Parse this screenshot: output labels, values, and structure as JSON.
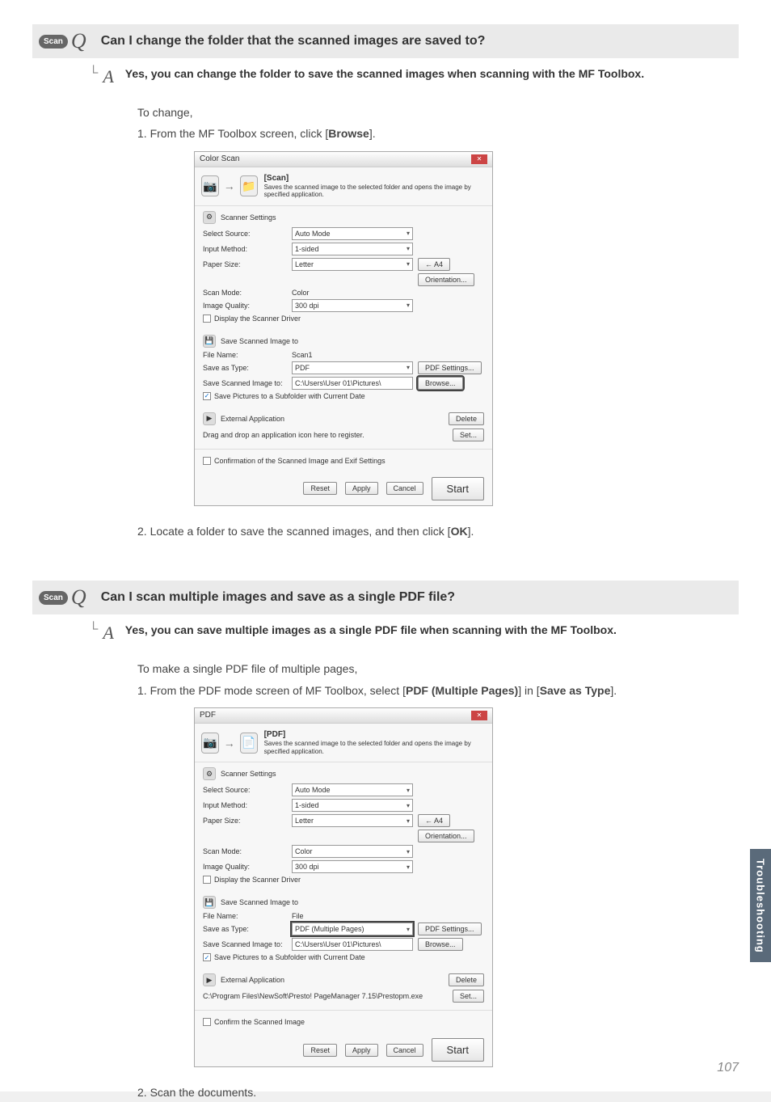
{
  "qa1": {
    "badge": "Scan",
    "q_letter": "Q",
    "a_letter": "A",
    "question": "Can I change the folder that the scanned images are saved to?",
    "answer": "Yes, you can change the folder to save the scanned images when scanning with the MF Toolbox.",
    "intro": "To change,",
    "step1_pre": "1. From the MF Toolbox screen, click [",
    "step1_bold": "Browse",
    "step1_post": "].",
    "step2_pre": "2. Locate a folder to save the scanned images, and then click [",
    "step2_bold": "OK",
    "step2_post": "]."
  },
  "dialog1": {
    "title": "Color Scan",
    "banner_title": "[Scan]",
    "banner_desc": "Saves the scanned image to the selected folder and opens the image by specified application.",
    "scanner_settings": "Scanner Settings",
    "select_source_label": "Select Source:",
    "select_source_value": "Auto Mode",
    "input_method_label": "Input Method:",
    "input_method_value": "1-sided",
    "paper_size_label": "Paper Size:",
    "paper_size_value": "Letter",
    "orientation_btn": "Orientation...",
    "arrow_btn": "← A4",
    "scan_mode_label": "Scan Mode:",
    "scan_mode_value": "Color",
    "image_quality_label": "Image Quality:",
    "image_quality_value": "300 dpi",
    "display_driver": "Display the Scanner Driver",
    "save_section": "Save Scanned Image to",
    "file_name_label": "File Name:",
    "file_name_value": "Scan1",
    "save_as_type_label": "Save as Type:",
    "save_as_type_value": "PDF",
    "pdf_settings_btn": "PDF Settings...",
    "save_to_label": "Save Scanned Image to:",
    "save_to_value": "C:\\Users\\User 01\\Pictures\\",
    "browse_btn": "Browse...",
    "subfolder": "Save Pictures to a Subfolder with Current Date",
    "external_app": "External Application",
    "drag_drop": "Drag and drop an application icon here to register.",
    "delete_btn": "Delete",
    "set_btn": "Set...",
    "confirm": "Confirmation of the Scanned Image and Exif Settings",
    "reset_btn": "Reset",
    "apply_btn": "Apply",
    "cancel_btn": "Cancel",
    "start_btn": "Start"
  },
  "qa2": {
    "badge": "Scan",
    "q_letter": "Q",
    "a_letter": "A",
    "question": "Can I scan multiple images and save as a single PDF file?",
    "answer": "Yes, you can save multiple images as a single PDF file when scanning with the MF Toolbox.",
    "intro": "To make a single PDF file of multiple pages,",
    "step1_pre": "1. From the PDF mode screen of MF Toolbox, select [",
    "step1_bold1": "PDF (Multiple Pages)",
    "step1_mid": "] in [",
    "step1_bold2": "Save as Type",
    "step1_post": "].",
    "step2": "2. Scan the documents."
  },
  "dialog2": {
    "title": "PDF",
    "banner_title": "[PDF]",
    "banner_desc": "Saves the scanned image to the selected folder and opens the image by specified application.",
    "scanner_settings": "Scanner Settings",
    "select_source_label": "Select Source:",
    "select_source_value": "Auto Mode",
    "input_method_label": "Input Method:",
    "input_method_value": "1-sided",
    "paper_size_label": "Paper Size:",
    "paper_size_value": "Letter",
    "orientation_btn": "Orientation...",
    "arrow_btn": "← A4",
    "scan_mode_label": "Scan Mode:",
    "scan_mode_value": "Color",
    "image_quality_label": "Image Quality:",
    "image_quality_value": "300 dpi",
    "display_driver": "Display the Scanner Driver",
    "save_section": "Save Scanned Image to",
    "file_name_label": "File Name:",
    "file_name_value": "File",
    "save_as_type_label": "Save as Type:",
    "save_as_type_value": "PDF (Multiple Pages)",
    "pdf_settings_btn": "PDF Settings...",
    "save_to_label": "Save Scanned Image to:",
    "save_to_value": "C:\\Users\\User 01\\Pictures\\",
    "browse_btn": "Browse...",
    "subfolder": "Save Pictures to a Subfolder with Current Date",
    "external_app": "External Application",
    "app_path": "C:\\Program Files\\NewSoft\\Presto! PageManager 7.15\\Prestopm.exe",
    "delete_btn": "Delete",
    "set_btn": "Set...",
    "confirm": "Confirm the Scanned Image",
    "reset_btn": "Reset",
    "apply_btn": "Apply",
    "cancel_btn": "Cancel",
    "start_btn": "Start"
  },
  "side_tab": "Troubleshooting",
  "page_number": "107"
}
